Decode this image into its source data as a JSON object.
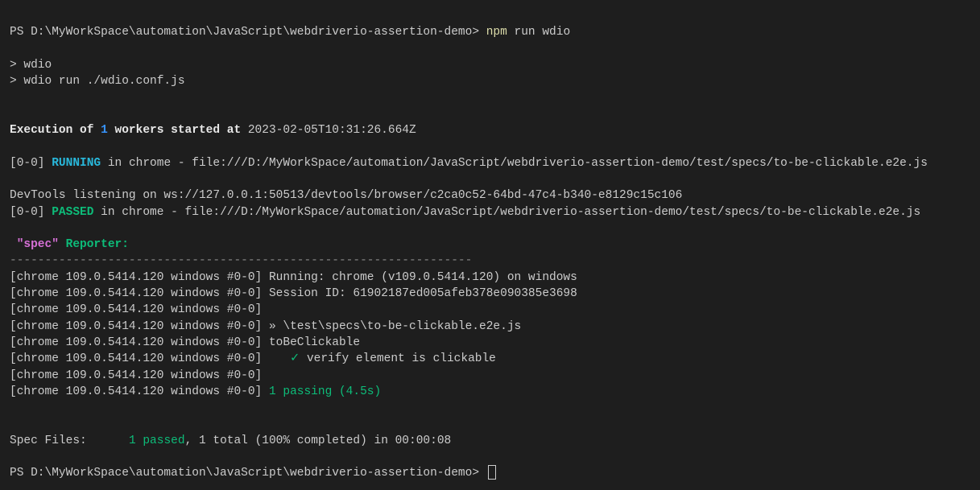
{
  "prompt": {
    "prefix": "PS ",
    "path": "D:\\MyWorkSpace\\automation\\JavaScript\\webdriverio-assertion-demo",
    "sep": "> "
  },
  "command": {
    "main": "npm",
    "rest": " run wdio"
  },
  "scriptEcho": {
    "line1": "> wdio",
    "line2": "> wdio run ./wdio.conf.js"
  },
  "execHeader": {
    "p1": "Execution of ",
    "count": "1",
    "p2": " workers started at",
    "ts": " 2023-02-05T10:31:26.664Z"
  },
  "runningLine": {
    "prefix": "[0-0] ",
    "status": "RUNNING",
    "rest": " in chrome - file:///D:/MyWorkSpace/automation/JavaScript/webdriverio-assertion-demo/test/specs/to-be-clickable.e2e.js"
  },
  "devtools": "DevTools listening on ws://127.0.0.1:50513/devtools/browser/c2ca0c52-64bd-47c4-b340-e8129c15c106",
  "passedLine": {
    "prefix": "[0-0] ",
    "status": "PASSED",
    "rest": " in chrome - file:///D:/MyWorkSpace/automation/JavaScript/webdriverio-assertion-demo/test/specs/to-be-clickable.e2e.js"
  },
  "reporter": {
    "spec": " \"spec\"",
    "label": " Reporter:"
  },
  "dashes": "------------------------------------------------------------------",
  "browserTag": "[chrome 109.0.5414.120 windows #0-0]",
  "specLines": {
    "running": " Running: chrome (v109.0.5414.120) on windows",
    "session": " Session ID: 61902187ed005afeb378e090385e3698",
    "blank": "",
    "specfile": " » \\test\\specs\\to-be-clickable.e2e.js",
    "suite": " toBeClickable",
    "checkPad": "    ",
    "check": "✓ ",
    "checktext": "verify element is clickable",
    "passing": " 1 passing (4.5s)"
  },
  "summary": {
    "label": "Spec Files:      ",
    "passed": "1 passed",
    "rest": ", 1 total (100% completed) in 00:00:08"
  }
}
